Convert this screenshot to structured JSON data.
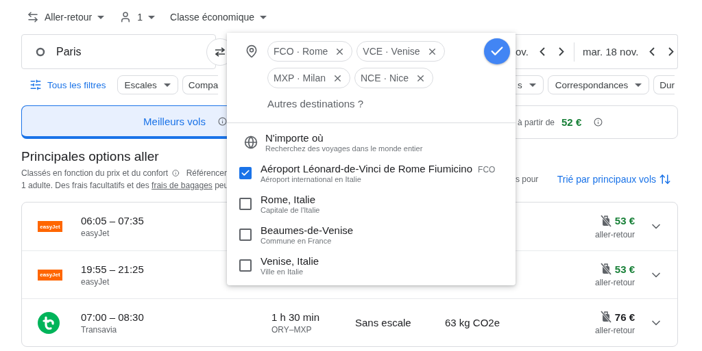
{
  "trip_options": [
    {
      "kind": "trip",
      "label": "Aller-retour"
    },
    {
      "kind": "passengers",
      "label": "1"
    },
    {
      "kind": "class",
      "label": "Classe économique"
    }
  ],
  "search": {
    "origin": "Paris",
    "departure_date": "ov.",
    "return_date": "mar. 18 nov."
  },
  "all_filters": "Tous les filtres",
  "filters_left": [
    "Escales",
    "Compa"
  ],
  "filters_right": [
    "s",
    "Correspondances",
    "Dur"
  ],
  "tabs": [
    {
      "label": "Meilleurs vols",
      "selected": true
    },
    {
      "price_prefix": "à partir de",
      "price": "52 €",
      "selected": false
    }
  ],
  "results": {
    "title": "Principales options aller",
    "ranking_note": "Classés en fonction du prix et du confort",
    "fees_note_start": "Référencer",
    "fees_line_2": "1 adulte. Des frais facultatifs et des",
    "fees_link": "frais de bagages",
    "fees_line_2_end": "peu",
    "fees_note_right": "s pour",
    "sort_label": "Trié par principaux vols"
  },
  "flights": [
    {
      "logo": {
        "kind": "badge",
        "text": "easyJet",
        "color": "#ff6600"
      },
      "times": "06:05 – 07:35",
      "airline": "easyJet",
      "price": "53 €",
      "lowest": true,
      "price_note": "aller-retour"
    },
    {
      "logo": {
        "kind": "badge",
        "text": "easyJet",
        "color": "#ff6600"
      },
      "times": "19:55 – 21:25",
      "airline": "easyJet",
      "price": "53 €",
      "lowest": true,
      "price_note": "aller-retour"
    },
    {
      "logo": {
        "kind": "mark",
        "color": "#00b45a"
      },
      "times": "07:00 – 08:30",
      "airline": "Transavia",
      "duration": "1 h 30 min",
      "route": "ORY–MXP",
      "stops": "Sans escale",
      "emissions": "63 kg CO2e",
      "price": "76 €",
      "lowest": false,
      "price_note": "aller-retour"
    }
  ],
  "destination_picker": {
    "chips": [
      "FCO · Rome",
      "VCE · Venise",
      "MXP · Milan",
      "NCE · Nice"
    ],
    "placeholder": "Autres destinations ?",
    "suggestions": [
      {
        "kind": "anywhere",
        "title": "N'importe où",
        "subtitle": "Recherchez des voyages dans le monde entier"
      },
      {
        "kind": "place",
        "title": "Aéroport Léonard-de-Vinci de Rome Fiumicino",
        "code": "FCO",
        "subtitle": "Aéroport international en Italie",
        "checked": true
      },
      {
        "kind": "place",
        "title": "Rome, Italie",
        "subtitle": "Capitale de l'Italie",
        "checked": false
      },
      {
        "kind": "place",
        "title": "Beaumes-de-Venise",
        "subtitle": "Commune en France",
        "checked": false
      },
      {
        "kind": "place",
        "title": "Venise, Italie",
        "subtitle": "Ville en Italie",
        "checked": false
      }
    ]
  }
}
